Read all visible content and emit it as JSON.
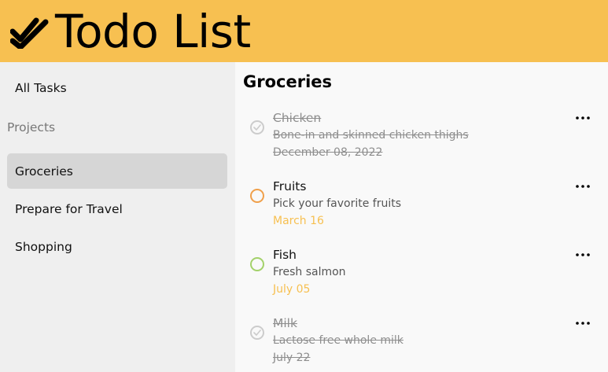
{
  "app": {
    "title": "Todo List"
  },
  "sidebar": {
    "all_tasks_label": "All Tasks",
    "projects_heading": "Projects",
    "projects": [
      {
        "label": "Groceries",
        "active": true
      },
      {
        "label": "Prepare for Travel",
        "active": false
      },
      {
        "label": "Shopping",
        "active": false
      }
    ]
  },
  "main": {
    "title": "Groceries",
    "tasks": [
      {
        "title": "Chicken",
        "description": "Bone-in and skinned chicken thighs",
        "date": "December 08, 2022",
        "completed": true
      },
      {
        "title": "Fruits",
        "description": "Pick your favorite fruits",
        "date": "March 16",
        "completed": false,
        "priority_color": "#f0a04b"
      },
      {
        "title": "Fish",
        "description": "Fresh salmon",
        "date": "July 05",
        "completed": false,
        "priority_color": "#a3d16a"
      },
      {
        "title": "Milk",
        "description": "Lactose free whole milk",
        "date": "July 22",
        "completed": true
      }
    ]
  },
  "colors": {
    "accent": "#f7c051",
    "sidebar_bg": "#efefef",
    "active_project_bg": "#d6d6d6",
    "completed_text": "#8e8e8e"
  },
  "icons": {
    "logo": "double-check-icon",
    "task_menu": "more-horizontal-icon",
    "completed_check": "checkmark-circle-icon"
  }
}
